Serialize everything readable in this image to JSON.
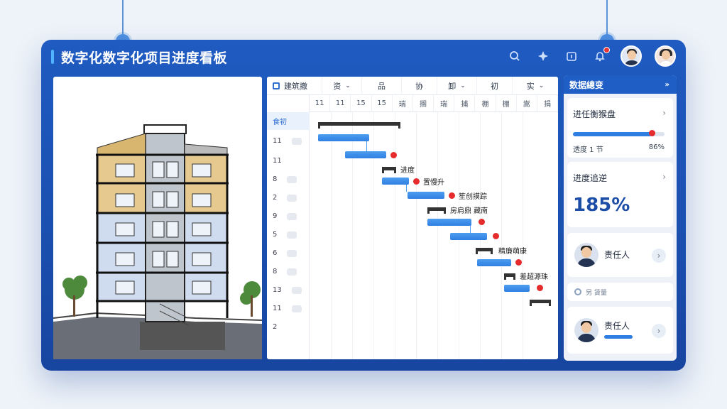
{
  "header": {
    "title": "数字化数字化项目进度看板"
  },
  "gantt": {
    "toolbar": [
      "建筑撤",
      "资",
      "品",
      "协",
      "卸",
      "初",
      "实"
    ],
    "days": [
      "11",
      "11",
      "15",
      "15",
      "瑞",
      "搁",
      "瑞",
      "捕",
      "棚",
      "棚",
      "嵩",
      "捐"
    ],
    "rows": [
      {
        "label": "食初",
        "chip": false
      },
      {
        "label": "11",
        "chip": true
      },
      {
        "label": "11",
        "chip": true
      },
      {
        "label": "8",
        "chip": true
      },
      {
        "label": "2",
        "chip": true
      },
      {
        "label": "9",
        "chip": true
      },
      {
        "label": "5",
        "chip": true
      },
      {
        "label": "6",
        "chip": true
      },
      {
        "label": "8",
        "chip": true
      },
      {
        "label": "13",
        "chip": true
      },
      {
        "label": "11",
        "chip": true
      },
      {
        "label": "2",
        "chip": false
      }
    ],
    "task_labels": [
      "进度",
      "置慢升",
      "笙创摸踪",
      "房肩鼎 藏南",
      "精廉萌康",
      "差超源珠"
    ]
  },
  "panel": {
    "title": "数据總变",
    "card1": {
      "title": "进任衡猴盘",
      "label": "透度 1 节",
      "value": "86%",
      "progress": 0.86
    },
    "card2": {
      "title": "进度追逆",
      "value": "185%"
    },
    "person1": {
      "role": "责任人"
    },
    "tag": "另 賃量",
    "person2": {
      "role": "责任人"
    }
  },
  "colors": {
    "frame": "#1f5bc1",
    "bar": "#2f7fe2",
    "milestone": "#e52b2b"
  }
}
